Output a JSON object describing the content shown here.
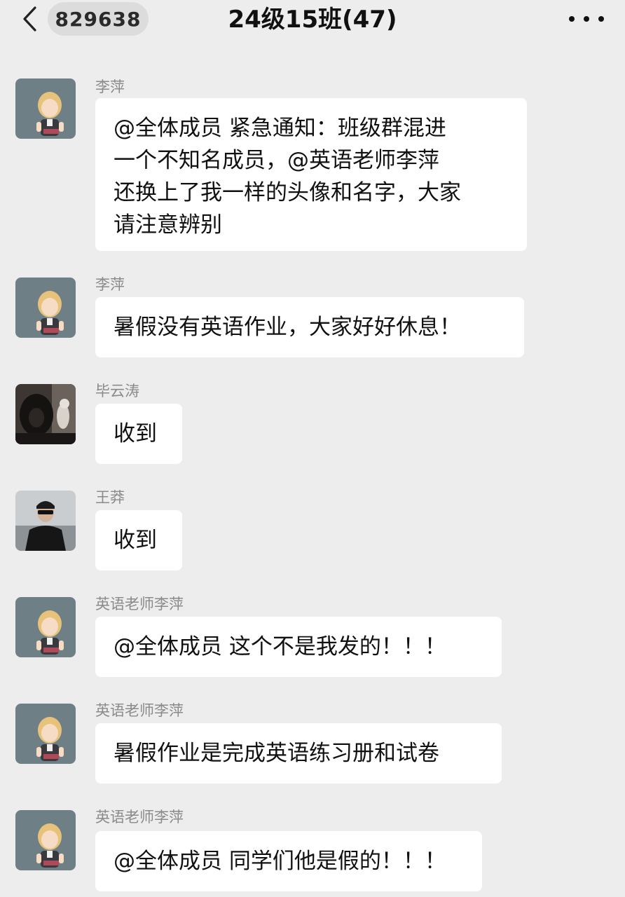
{
  "header": {
    "unread_count": "829638",
    "title": "24级15班(47)"
  },
  "messages": [
    {
      "sender": "李萍",
      "avatar": "teacher-cartoon-avatar",
      "text": "@全体成员 紧急通知：班级群混进\n一个不知名成员，@英语老师李萍\n还换上了我一样的头像和名字，大家\n请注意辨别"
    },
    {
      "sender": "李萍",
      "avatar": "teacher-cartoon-avatar",
      "text": "暑假没有英语作业，大家好好休息！"
    },
    {
      "sender": "毕云涛",
      "avatar": "hooded-figure-avatar",
      "text": "收到"
    },
    {
      "sender": "王莽",
      "avatar": "man-sunglasses-avatar",
      "text": "收到"
    },
    {
      "sender": "英语老师李萍",
      "avatar": "teacher-cartoon-avatar",
      "text": "@全体成员 这个不是我发的！！！"
    },
    {
      "sender": "英语老师李萍",
      "avatar": "teacher-cartoon-avatar",
      "text": "暑假作业是完成英语练习册和试卷"
    },
    {
      "sender": "英语老师李萍",
      "avatar": "teacher-cartoon-avatar",
      "text": "@全体成员 同学们他是假的！！！"
    }
  ],
  "colors": {
    "background": "#ededed",
    "bubble": "#ffffff",
    "sender_name": "#8a8a8a",
    "avatar_teacher_bg": "#6f7f86"
  }
}
